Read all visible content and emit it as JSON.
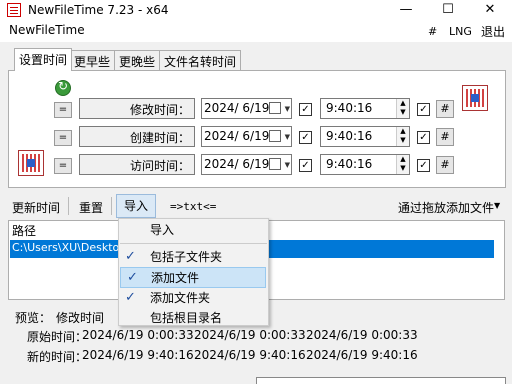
{
  "window": {
    "title": "NewFileTime 7.23 - x64",
    "controls": [
      "—",
      "☐",
      "✕"
    ]
  },
  "menubar": {
    "app_label": "NewFileTime",
    "hash": "#",
    "lng": "LNG",
    "exit": "退出"
  },
  "tabs": [
    "设置时间",
    "更早些",
    "更晚些",
    "文件名转时间"
  ],
  "rows": [
    {
      "eq": "=",
      "label": "修改时间：",
      "date": "2024/ 6/19",
      "time": "9:40:16",
      "hash": "#"
    },
    {
      "eq": "=",
      "label": "创建时间：",
      "date": "2024/ 6/19",
      "time": "9:40:16",
      "hash": "#"
    },
    {
      "eq": "=",
      "label": "访问时间：",
      "date": "2024/ 6/19",
      "time": "9:40:16",
      "hash": "#"
    }
  ],
  "toolbar": {
    "refresh": "更新时间",
    "reset": "重置",
    "import": "导入",
    "txt": "=>txt<=",
    "drag_add": "通过拖放添加文件",
    "drag_add_arrow": "▼"
  },
  "list": {
    "header": "路径",
    "selected_path": "C:\\Users\\XU\\Desktop\\"
  },
  "popup": {
    "items": [
      {
        "label": "导入",
        "checked": false,
        "highlight": false
      },
      {
        "label": "包括子文件夹",
        "checked": true,
        "highlight": false
      },
      {
        "label": "添加文件",
        "checked": true,
        "highlight": true
      },
      {
        "label": "添加文件夹",
        "checked": true,
        "highlight": false
      },
      {
        "label": "包括根目录名",
        "checked": false,
        "highlight": false
      }
    ]
  },
  "preview": {
    "label": "预览：",
    "mod_label": "修改时间",
    "orig_label": "原始时间：",
    "new_label": "新的时间：",
    "orig_values": [
      "2024/6/19 0:00:33",
      "2024/6/19 0:00:33",
      "2024/6/19 0:00:33"
    ],
    "new_values": [
      "2024/6/19 9:40:16",
      "2024/6/19 9:40:16",
      "2024/6/19 9:40:16"
    ]
  },
  "colors": {
    "selection": "#0078d7",
    "menu_highlight": "#cce4f7",
    "check": "#1f4e9e"
  }
}
